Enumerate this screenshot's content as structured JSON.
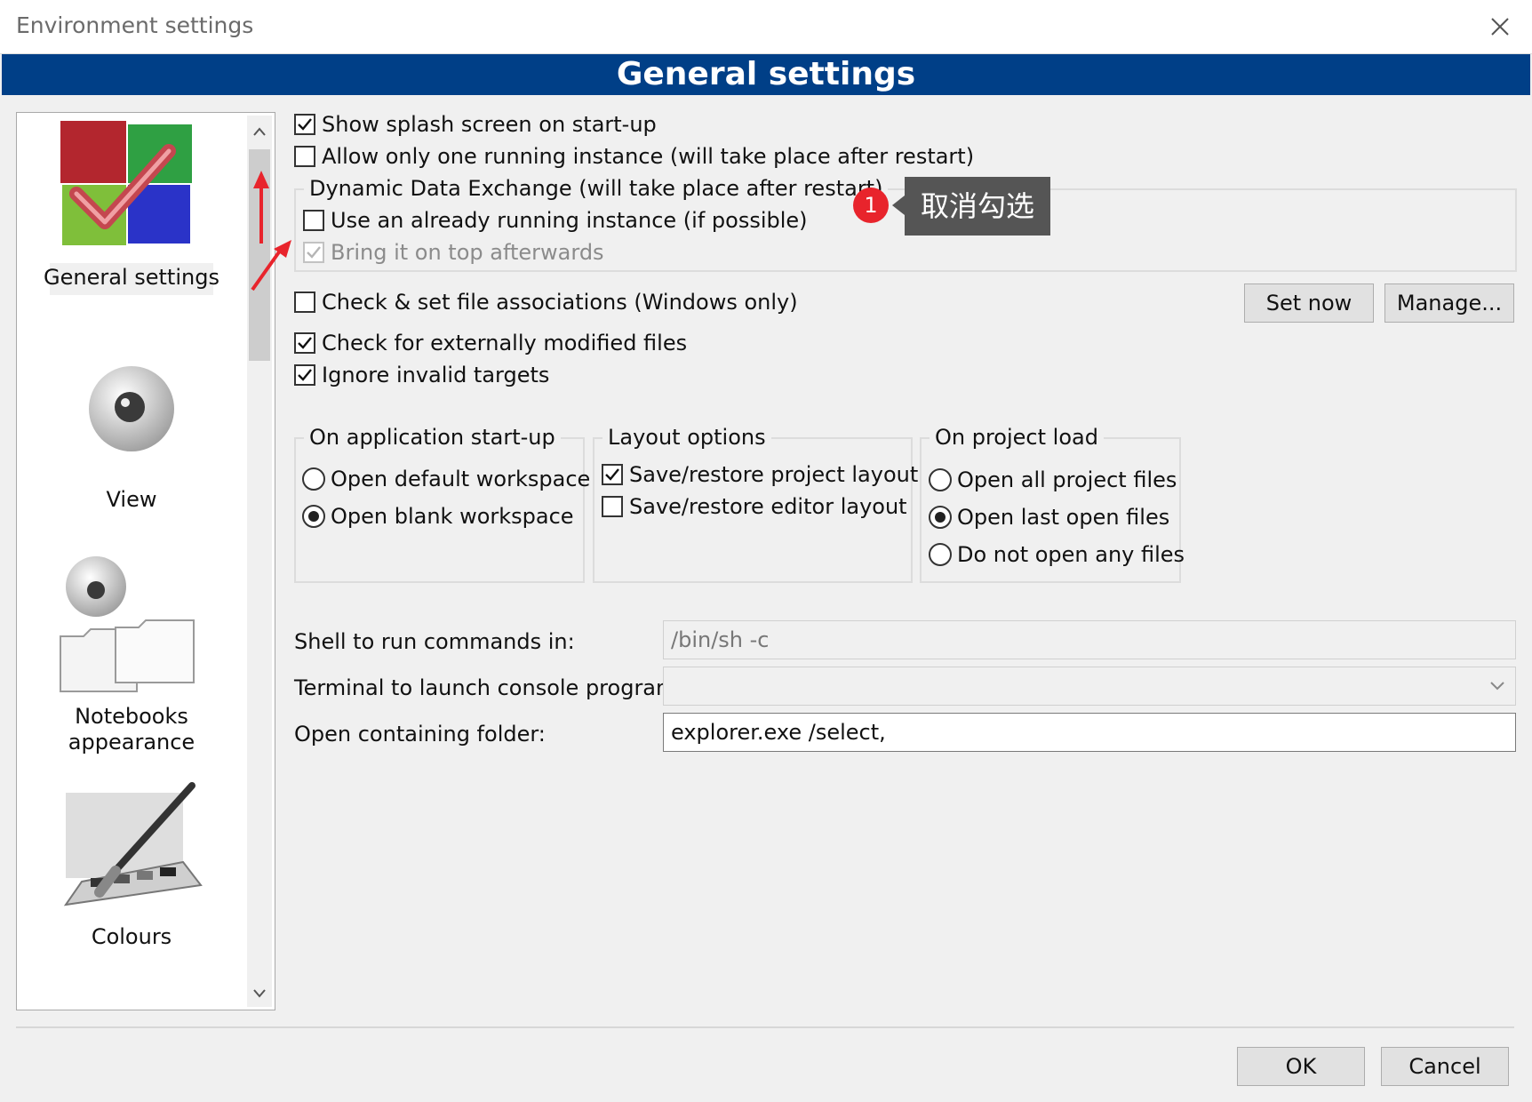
{
  "window": {
    "title": "Environment settings",
    "close_icon": "close-icon"
  },
  "header": {
    "title": "General settings",
    "background": "#003f87"
  },
  "sidebar": {
    "items": [
      {
        "label": "General settings",
        "icon": "general-settings-icon",
        "selected": true
      },
      {
        "label": "View",
        "icon": "view-icon"
      },
      {
        "label_line1": "Notebooks",
        "label_line2": "appearance",
        "icon": "notebooks-appearance-icon"
      },
      {
        "label": "Colours",
        "icon": "colours-icon"
      }
    ]
  },
  "general": {
    "splash": {
      "label": "Show splash screen on start-up",
      "checked": true
    },
    "single_instance": {
      "label": "Allow only one running instance (will take place after restart)",
      "checked": false
    },
    "dde": {
      "legend": "Dynamic Data Exchange (will take place after restart)",
      "use_running": {
        "label": "Use an already running instance (if possible)",
        "checked": false
      },
      "bring_top": {
        "label": "Bring it on top afterwards",
        "checked": true,
        "disabled": true
      }
    },
    "file_assoc": {
      "label": "Check & set file associations (Windows only)",
      "checked": false
    },
    "set_now_label": "Set now",
    "manage_label": "Manage...",
    "ext_modified": {
      "label": "Check for externally modified files",
      "checked": true
    },
    "ignore_invalid": {
      "label": "Ignore invalid targets",
      "checked": true
    }
  },
  "startup": {
    "legend": "On application start-up",
    "options": [
      {
        "label": "Open default workspace",
        "selected": false
      },
      {
        "label": "Open blank workspace",
        "selected": true
      }
    ]
  },
  "layout": {
    "legend": "Layout options",
    "options": [
      {
        "label": "Save/restore project layout",
        "checked": true
      },
      {
        "label": "Save/restore editor layout",
        "checked": false
      }
    ]
  },
  "project_load": {
    "legend": "On project load",
    "options": [
      {
        "label": "Open all project files",
        "selected": false
      },
      {
        "label": "Open last open files",
        "selected": true
      },
      {
        "label": "Do not open any files",
        "selected": false
      }
    ]
  },
  "commands": {
    "shell_label": "Shell to run commands in:",
    "shell_value": "/bin/sh -c",
    "terminal_label": "Terminal to launch console programs:",
    "terminal_value": "",
    "folder_label": "Open containing folder:",
    "folder_value": "explorer.exe /select,"
  },
  "footer": {
    "ok_label": "OK",
    "cancel_label": "Cancel"
  },
  "annotation": {
    "badge": "1",
    "text": "取消勾选",
    "color": "#e8242c"
  }
}
